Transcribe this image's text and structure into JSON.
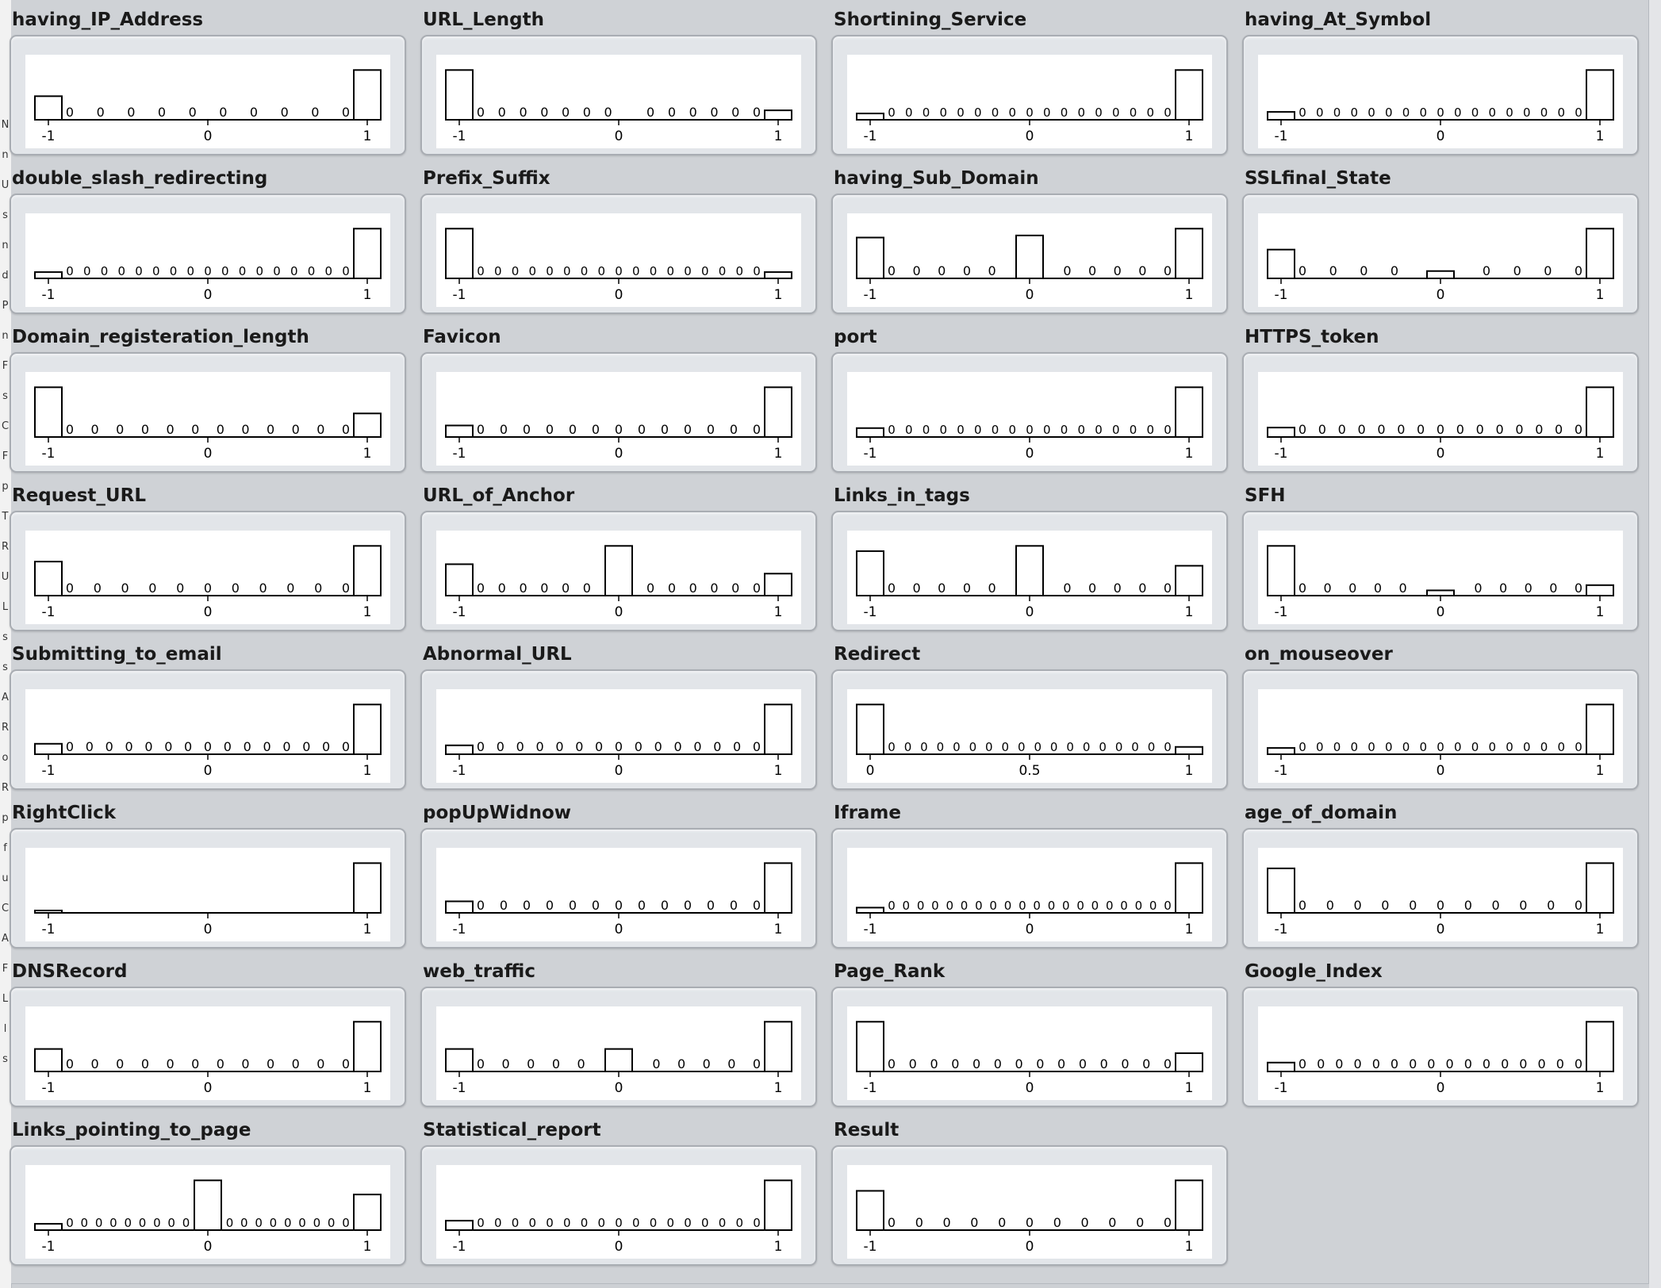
{
  "left_strip_chars": [
    "N",
    "n",
    "U",
    "s",
    "n",
    "d",
    "P",
    "n",
    "F",
    "s",
    "C",
    "F",
    "p",
    "T",
    "R",
    "U",
    "L",
    "s",
    "s",
    "A",
    "R",
    "o",
    "R",
    "p",
    "f",
    "u",
    "C",
    "A",
    "F",
    "L",
    "l",
    "s"
  ],
  "chart_data": [
    {
      "type": "bar",
      "title": "having_IP_Address",
      "x_ticks": [
        "-1",
        "0",
        "1"
      ],
      "bars": [
        {
          "x": -1,
          "v": 0.45
        },
        {
          "x": 1,
          "v": 0.95
        }
      ],
      "zeros": 10,
      "gaps": []
    },
    {
      "type": "bar",
      "title": "URL_Length",
      "x_ticks": [
        "-1",
        "0",
        "1"
      ],
      "bars": [
        {
          "x": -1,
          "v": 0.95
        },
        {
          "x": 1,
          "v": 0.18
        }
      ],
      "zeros": 13,
      "gaps": [
        7
      ]
    },
    {
      "type": "bar",
      "title": "Shortining_Service",
      "x_ticks": [
        "-1",
        "0",
        "1"
      ],
      "bars": [
        {
          "x": -1,
          "v": 0.12
        },
        {
          "x": 1,
          "v": 0.95
        }
      ],
      "zeros": 17,
      "gaps": []
    },
    {
      "type": "bar",
      "title": "having_At_Symbol",
      "x_ticks": [
        "-1",
        "0",
        "1"
      ],
      "bars": [
        {
          "x": -1,
          "v": 0.15
        },
        {
          "x": 1,
          "v": 0.95
        }
      ],
      "zeros": 17,
      "gaps": []
    },
    {
      "type": "bar",
      "title": "double_slash_redirecting",
      "x_ticks": [
        "-1",
        "0",
        "1"
      ],
      "bars": [
        {
          "x": -1,
          "v": 0.12
        },
        {
          "x": 1,
          "v": 0.95
        }
      ],
      "zeros": 17,
      "gaps": []
    },
    {
      "type": "bar",
      "title": "Prefix_Suffix",
      "x_ticks": [
        "-1",
        "0",
        "1"
      ],
      "bars": [
        {
          "x": -1,
          "v": 0.95
        },
        {
          "x": 1,
          "v": 0.12
        }
      ],
      "zeros": 17,
      "gaps": []
    },
    {
      "type": "bar",
      "title": "having_Sub_Domain",
      "x_ticks": [
        "-1",
        "0",
        "1"
      ],
      "bars": [
        {
          "x": -1,
          "v": 0.78
        },
        {
          "x": 0,
          "v": 0.82
        },
        {
          "x": 1,
          "v": 0.95
        }
      ],
      "zeros": 12,
      "gaps": []
    },
    {
      "type": "bar",
      "title": "SSLfinal_State",
      "x_ticks": [
        "-1",
        "0",
        "1"
      ],
      "bars": [
        {
          "x": -1,
          "v": 0.55
        },
        {
          "x": 0,
          "v": 0.14
        },
        {
          "x": 1,
          "v": 0.95
        }
      ],
      "zeros": 10,
      "gaps": []
    },
    {
      "type": "bar",
      "title": "Domain_registeration_length",
      "x_ticks": [
        "-1",
        "0",
        "1"
      ],
      "bars": [
        {
          "x": -1,
          "v": 0.95
        },
        {
          "x": 1,
          "v": 0.45
        }
      ],
      "zeros": 12,
      "gaps": []
    },
    {
      "type": "bar",
      "title": "Favicon",
      "x_ticks": [
        "-1",
        "0",
        "1"
      ],
      "bars": [
        {
          "x": -1,
          "v": 0.22
        },
        {
          "x": 1,
          "v": 0.95
        }
      ],
      "zeros": 13,
      "gaps": []
    },
    {
      "type": "bar",
      "title": "port",
      "x_ticks": [
        "-1",
        "0",
        "1"
      ],
      "bars": [
        {
          "x": -1,
          "v": 0.17
        },
        {
          "x": 1,
          "v": 0.95
        }
      ],
      "zeros": 17,
      "gaps": []
    },
    {
      "type": "bar",
      "title": "HTTPS_token",
      "x_ticks": [
        "-1",
        "0",
        "1"
      ],
      "bars": [
        {
          "x": -1,
          "v": 0.18
        },
        {
          "x": 1,
          "v": 0.95
        }
      ],
      "zeros": 15,
      "gaps": []
    },
    {
      "type": "bar",
      "title": "Request_URL",
      "x_ticks": [
        "-1",
        "0",
        "1"
      ],
      "bars": [
        {
          "x": -1,
          "v": 0.65
        },
        {
          "x": 1,
          "v": 0.95
        }
      ],
      "zeros": 11,
      "gaps": []
    },
    {
      "type": "bar",
      "title": "URL_of_Anchor",
      "x_ticks": [
        "-1",
        "0",
        "1"
      ],
      "bars": [
        {
          "x": -1,
          "v": 0.6
        },
        {
          "x": 0,
          "v": 0.95
        },
        {
          "x": 1,
          "v": 0.42
        }
      ],
      "zeros": 14,
      "gaps": []
    },
    {
      "type": "bar",
      "title": "Links_in_tags",
      "x_ticks": [
        "-1",
        "0",
        "1"
      ],
      "bars": [
        {
          "x": -1,
          "v": 0.85
        },
        {
          "x": 0,
          "v": 0.95
        },
        {
          "x": 1,
          "v": 0.57
        }
      ],
      "zeros": 12,
      "gaps": []
    },
    {
      "type": "bar",
      "title": "SFH",
      "x_ticks": [
        "-1",
        "0",
        "1"
      ],
      "bars": [
        {
          "x": -1,
          "v": 0.95
        },
        {
          "x": 0,
          "v": 0.1
        },
        {
          "x": 1,
          "v": 0.2
        }
      ],
      "zeros": 12,
      "gaps": []
    },
    {
      "type": "bar",
      "title": "Submitting_to_email",
      "x_ticks": [
        "-1",
        "0",
        "1"
      ],
      "bars": [
        {
          "x": -1,
          "v": 0.2
        },
        {
          "x": 1,
          "v": 0.95
        }
      ],
      "zeros": 15,
      "gaps": []
    },
    {
      "type": "bar",
      "title": "Abnormal_URL",
      "x_ticks": [
        "-1",
        "0",
        "1"
      ],
      "bars": [
        {
          "x": -1,
          "v": 0.17
        },
        {
          "x": 1,
          "v": 0.95
        }
      ],
      "zeros": 15,
      "gaps": []
    },
    {
      "type": "bar",
      "title": "Redirect",
      "x_ticks": [
        "0",
        "0.5",
        "1"
      ],
      "bars": [
        {
          "x": 0,
          "v": 0.95
        },
        {
          "x": 1,
          "v": 0.14
        }
      ],
      "zeros": 18,
      "gaps": [],
      "xlim": [
        0,
        1
      ]
    },
    {
      "type": "bar",
      "title": "on_mouseover",
      "x_ticks": [
        "-1",
        "0",
        "1"
      ],
      "bars": [
        {
          "x": -1,
          "v": 0.12
        },
        {
          "x": 1,
          "v": 0.95
        }
      ],
      "zeros": 17,
      "gaps": []
    },
    {
      "type": "bar",
      "title": "RightClick",
      "x_ticks": [
        "-1",
        "0",
        "1"
      ],
      "bars": [
        {
          "x": -1,
          "v": 0.04
        },
        {
          "x": 1,
          "v": 0.95
        }
      ],
      "zeros": 0,
      "gaps": []
    },
    {
      "type": "bar",
      "title": "popUpWidnow",
      "x_ticks": [
        "-1",
        "0",
        "1"
      ],
      "bars": [
        {
          "x": -1,
          "v": 0.22
        },
        {
          "x": 1,
          "v": 0.95
        }
      ],
      "zeros": 13,
      "gaps": []
    },
    {
      "type": "bar",
      "title": "Iframe",
      "x_ticks": [
        "-1",
        "0",
        "1"
      ],
      "bars": [
        {
          "x": -1,
          "v": 0.1
        },
        {
          "x": 1,
          "v": 0.95
        }
      ],
      "zeros": 20,
      "gaps": []
    },
    {
      "type": "bar",
      "title": "age_of_domain",
      "x_ticks": [
        "-1",
        "0",
        "1"
      ],
      "bars": [
        {
          "x": -1,
          "v": 0.85
        },
        {
          "x": 1,
          "v": 0.95
        }
      ],
      "zeros": 11,
      "gaps": []
    },
    {
      "type": "bar",
      "title": "DNSRecord",
      "x_ticks": [
        "-1",
        "0",
        "1"
      ],
      "bars": [
        {
          "x": -1,
          "v": 0.43
        },
        {
          "x": 1,
          "v": 0.95
        }
      ],
      "zeros": 12,
      "gaps": []
    },
    {
      "type": "bar",
      "title": "web_traffic",
      "x_ticks": [
        "-1",
        "0",
        "1"
      ],
      "bars": [
        {
          "x": -1,
          "v": 0.43
        },
        {
          "x": 0,
          "v": 0.43
        },
        {
          "x": 1,
          "v": 0.95
        }
      ],
      "zeros": 12,
      "gaps": []
    },
    {
      "type": "bar",
      "title": "Page_Rank",
      "x_ticks": [
        "-1",
        "0",
        "1"
      ],
      "bars": [
        {
          "x": -1,
          "v": 0.95
        },
        {
          "x": 1,
          "v": 0.35
        }
      ],
      "zeros": 14,
      "gaps": []
    },
    {
      "type": "bar",
      "title": "Google_Index",
      "x_ticks": [
        "-1",
        "0",
        "1"
      ],
      "bars": [
        {
          "x": -1,
          "v": 0.17
        },
        {
          "x": 1,
          "v": 0.95
        }
      ],
      "zeros": 16,
      "gaps": []
    },
    {
      "type": "bar",
      "title": "Links_pointing_to_page",
      "x_ticks": [
        "-1",
        "0",
        "1"
      ],
      "bars": [
        {
          "x": -1,
          "v": 0.12
        },
        {
          "x": 0,
          "v": 0.95
        },
        {
          "x": 1,
          "v": 0.68
        }
      ],
      "zeros": 20,
      "gaps": []
    },
    {
      "type": "bar",
      "title": "Statistical_report",
      "x_ticks": [
        "-1",
        "0",
        "1"
      ],
      "bars": [
        {
          "x": -1,
          "v": 0.18
        },
        {
          "x": 1,
          "v": 0.95
        }
      ],
      "zeros": 17,
      "gaps": []
    },
    {
      "type": "bar",
      "title": "Result",
      "x_ticks": [
        "-1",
        "0",
        "1"
      ],
      "bars": [
        {
          "x": -1,
          "v": 0.75
        },
        {
          "x": 1,
          "v": 0.95
        }
      ],
      "zeros": 11,
      "gaps": []
    }
  ]
}
